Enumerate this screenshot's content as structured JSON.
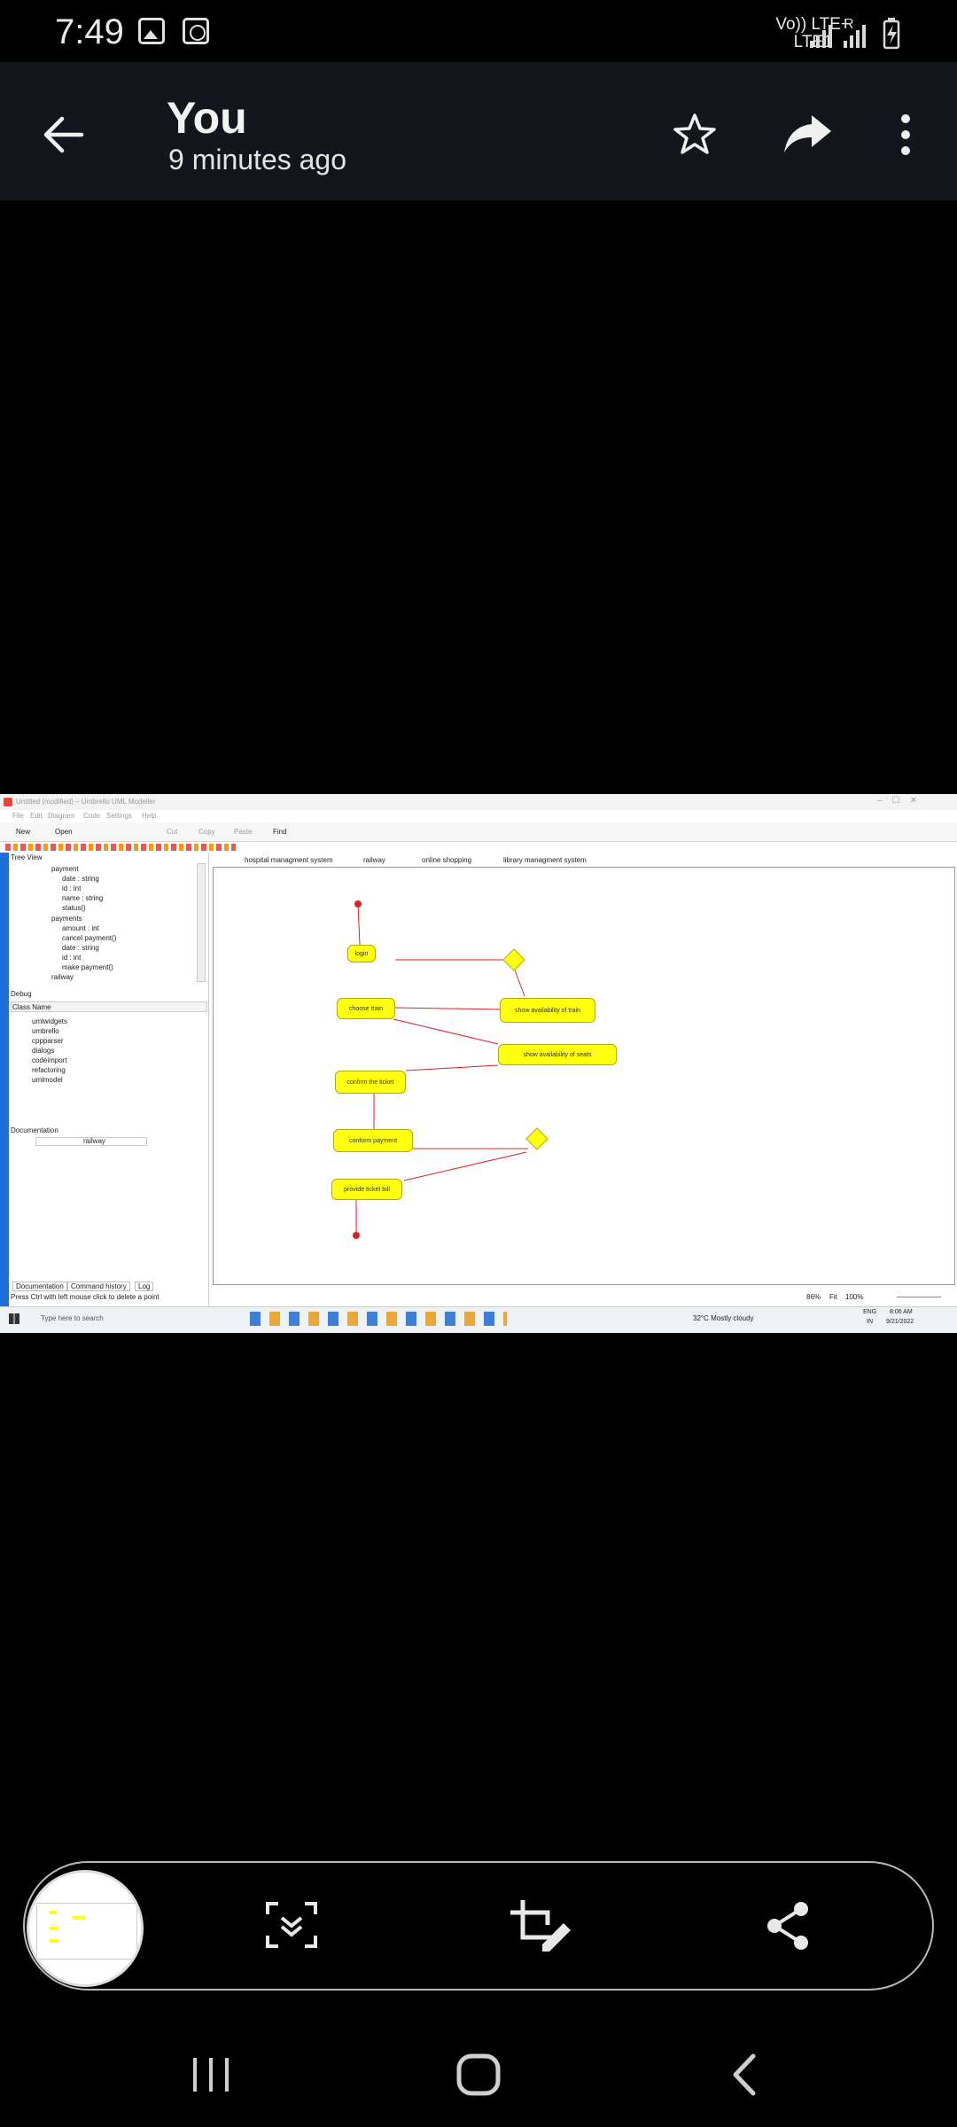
{
  "status_bar": {
    "time": "7:49",
    "network_top": "Vo)) LTE+",
    "network_bottom": "LTE1",
    "sim_label": "R"
  },
  "header": {
    "title": "You",
    "subtitle": "9 minutes ago"
  },
  "screenshot": {
    "window_title": "Untitled (modified) – Umbrello UML Modeller",
    "menu": [
      "File",
      "Edit",
      "Diagram",
      "Code",
      "Settings",
      "Help"
    ],
    "toolbar": [
      "New",
      "Open",
      "Cut",
      "Copy",
      "Paste",
      "Find"
    ],
    "tree_view": {
      "title": "Tree View",
      "items": [
        "payment",
        "date : string",
        "id : int",
        "name : string",
        "status()",
        "payments",
        "amount : int",
        "cancel payment()",
        "date : string",
        "id : int",
        "make payment()",
        "railway"
      ]
    },
    "debug": {
      "title": "Debug",
      "header": "Class Name",
      "items": [
        "umlwidgets",
        "umbrello",
        "cppparser",
        "dialogs",
        "codeimport",
        "refactoring",
        "umlmodel"
      ]
    },
    "documentation": {
      "title": "Documentation",
      "field": "railway",
      "tabs": [
        "Documentation",
        "Command history",
        "Log"
      ]
    },
    "diagram_tabs": [
      "hospital managment system",
      "railway",
      "online shopping",
      "library managment system"
    ],
    "nodes": [
      "login",
      "choose train",
      "show availability of train",
      "show availability of seats",
      "confirm the ticket",
      "conform payment",
      "provide ticket bill"
    ],
    "status_text": "Press Ctrl with left mouse click to delete a point",
    "zoom": {
      "percent": "86%",
      "fit": "Fit",
      "hundred": "100%"
    },
    "taskbar": {
      "search": "Type here to search",
      "weather": "32°C  Mostly cloudy",
      "lang": "ENG",
      "region": "IN",
      "time": "8:06 AM",
      "date": "9/21/2022"
    }
  },
  "colors": {
    "appbar": "#13171d",
    "node_fill": "#ffff10",
    "edge": "#e02020",
    "accent": "#1e6fd9"
  }
}
